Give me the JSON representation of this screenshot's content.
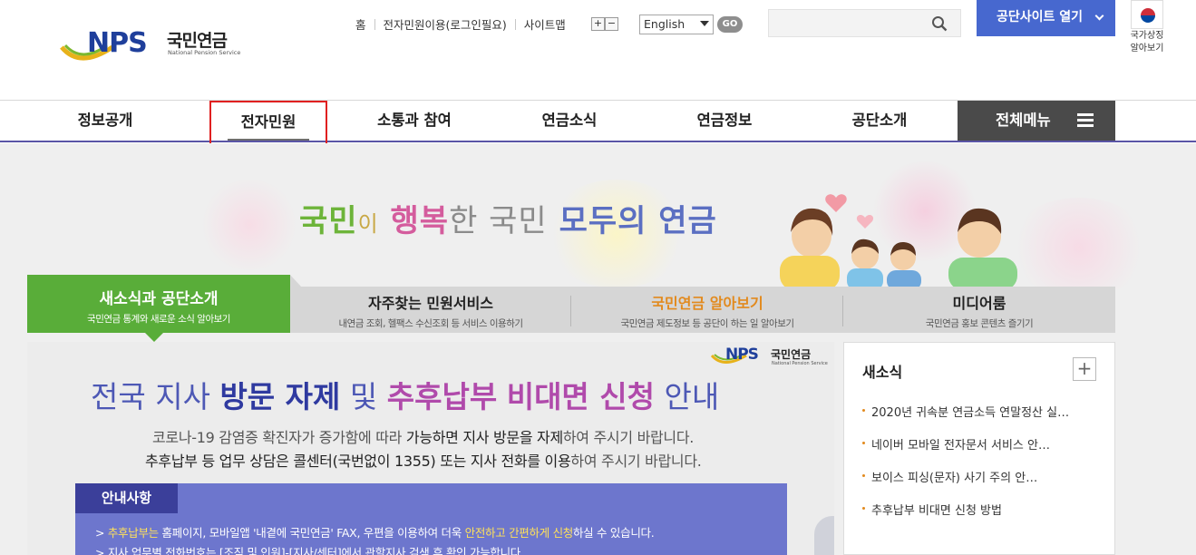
{
  "logo": {
    "mark": "NPS",
    "name_ko": "국민연금",
    "name_en": "National Pension Service"
  },
  "util_links": [
    "홈",
    "전자민원이용(로그인필요)",
    "사이트맵"
  ],
  "zoom": {
    "plus": "+",
    "minus": "−"
  },
  "language": {
    "selected": "English",
    "go_label": "GO"
  },
  "site_button": "공단사이트 열기",
  "emblem": {
    "line1": "국가상징",
    "line2": "알아보기"
  },
  "gnb": {
    "items": [
      "정보공개",
      "전자민원",
      "소통과 참여",
      "연금소식",
      "연금정보",
      "공단소개"
    ],
    "all_menu": "전체메뉴"
  },
  "slogan": {
    "w1": "국민",
    "w2": "이",
    "w3": "행복",
    "w4": "한 국민",
    "w5": "모두의 연금"
  },
  "tabs": [
    {
      "title": "새소식과 공단소개",
      "sub": "국민연금 통계와 새로운 소식 알아보기"
    },
    {
      "title": "자주찾는 민원서비스",
      "sub": "내연금 조회, 헬팩스 수신조회 등 서비스 이용하기"
    },
    {
      "title": "국민연금 알아보기",
      "sub": "국민연금 제도정보 등 공단이 하는 일 알아보기"
    },
    {
      "title": "미디어룸",
      "sub": "국민연금 홍보 콘텐츠 즐기기"
    }
  ],
  "banner": {
    "logo_mark": "NPS",
    "logo_ko": "국민연금",
    "logo_en": "National Pension Service",
    "h1": "전국 지사",
    "h2": "방문 자제",
    "h3": "및",
    "h4": "추후납부",
    "h5": "비대면 신청",
    "h6": "안내",
    "l1a": "코로나-19 감염증 확진자가 증가함에 따라",
    "l1b": "가능하면 지사 방문을 자제",
    "l1c": "하여 주시기 바랍니다.",
    "l2a": "추후납부 등 업무 상담은 콜센터(국번없이 1355) 또는 지사 전화를 이용",
    "l2b": "하여 주시기 바랍니다.",
    "notice_title": "안내사항",
    "n1a": "> ",
    "n1b": "추후납부는",
    "n1c": " 홈페이지, 모바일앱 '내곁에 국민연금' FAX, 우편을 이용하여 더욱 ",
    "n1d": "안전하고 간편하게 신청",
    "n1e": "하실 수 있습니다.",
    "n2": "> 지사 업무별 전화번호는 [조직 및 인원]-[지사/센터]에서 관할지사 검색 후 확인 가능합니다."
  },
  "news": {
    "title": "새소식",
    "more": "+",
    "items": [
      "2020년 귀속분 연금소득 연말정산 실…",
      "네이버 모바일 전자문서 서비스 안…",
      "보이스 피싱(문자) 사기 주의 안…",
      "추후납부 비대면 신청 방법"
    ]
  },
  "colors": {
    "brand_blue": "#4768cf",
    "tab_green": "#59ad39",
    "gnb_line": "#5a55a6",
    "highlight": "#e02020"
  }
}
